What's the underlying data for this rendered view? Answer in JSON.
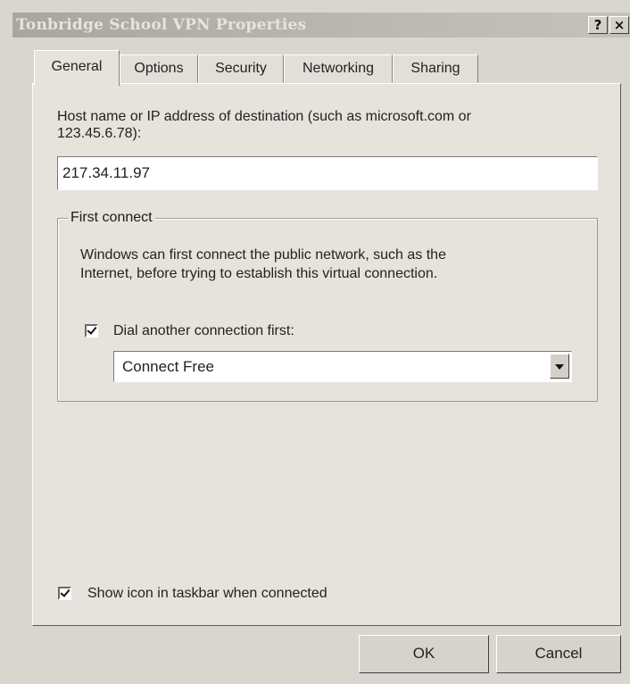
{
  "window": {
    "title": "Tonbridge School VPN Properties",
    "help_button": "?",
    "close_button": "×"
  },
  "tabs": [
    {
      "label": "General",
      "active": true
    },
    {
      "label": "Options",
      "active": false
    },
    {
      "label": "Security",
      "active": false
    },
    {
      "label": "Networking",
      "active": false
    },
    {
      "label": "Sharing",
      "active": false
    }
  ],
  "general": {
    "host_label_line1": "Host name or IP address of destination (such as microsoft.com or",
    "host_label_line2": "123.45.6.78):",
    "host_value": "217.34.11.97",
    "first_connect": {
      "legend": "First connect",
      "description_line1": "Windows can first connect the public network, such as the",
      "description_line2": "Internet, before trying to establish this virtual connection.",
      "dial_checkbox_label": "Dial another connection first:",
      "dial_checked": true,
      "connection_selected": "Connect Free"
    },
    "show_icon_label": "Show icon in taskbar when connected",
    "show_icon_checked": true
  },
  "buttons": {
    "ok": "OK",
    "cancel": "Cancel"
  }
}
